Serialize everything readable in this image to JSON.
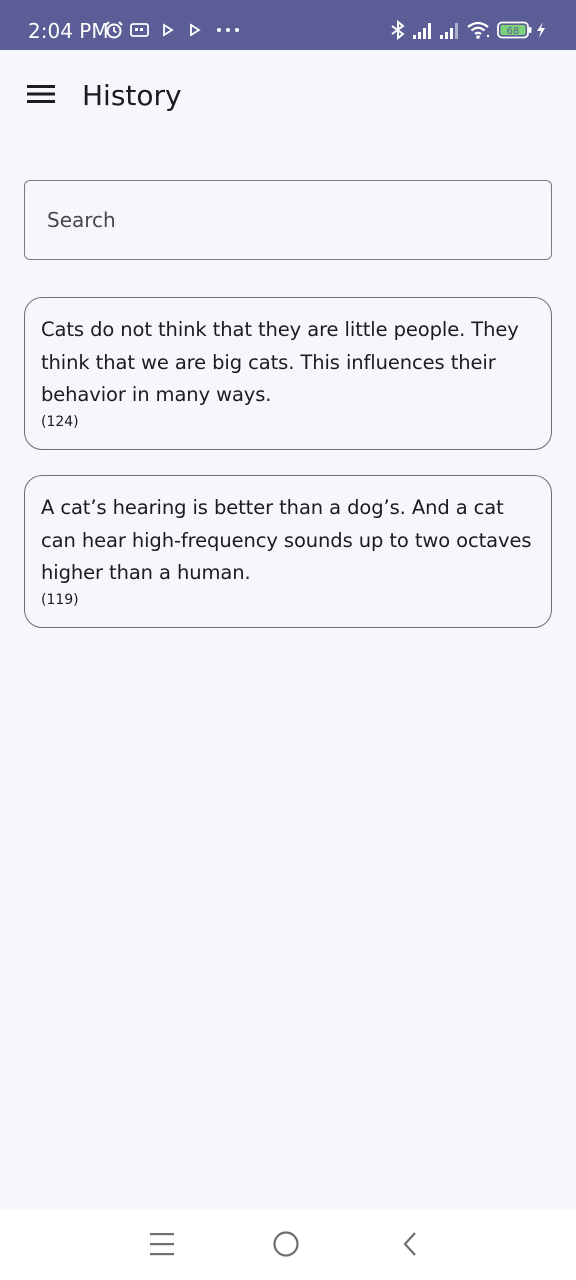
{
  "status_bar": {
    "time": "2:04 PM",
    "background_color": "#5b5e96",
    "left_icons": [
      "alarm-icon",
      "cast-icon",
      "play-icon",
      "play-icon",
      "more-dots-icon"
    ],
    "right_icons": [
      "bluetooth-icon",
      "signal-icon",
      "signal-icon",
      "wifi-icon",
      "battery-icon",
      "charging-icon"
    ],
    "battery_level": "68"
  },
  "app_bar": {
    "title": "History",
    "menu_icon": "hamburger-menu-icon"
  },
  "search": {
    "placeholder": "Search",
    "value": ""
  },
  "facts": [
    {
      "text": "Cats do not think that they are little people. They think that we are big cats. This influences their behavior in many ways.",
      "length": "(124)"
    },
    {
      "text": "A cat’s hearing is better than a dog’s. And a cat can hear high-frequency sounds up to two octaves higher than a human.",
      "length": "(119)"
    }
  ],
  "nav_bar": {
    "buttons": [
      "recents-icon",
      "home-icon",
      "back-icon"
    ]
  },
  "colors": {
    "background": "#f7f6fd",
    "accent": "#5b5e96",
    "text": "#1c1b1f",
    "outline": "#7a7880"
  }
}
